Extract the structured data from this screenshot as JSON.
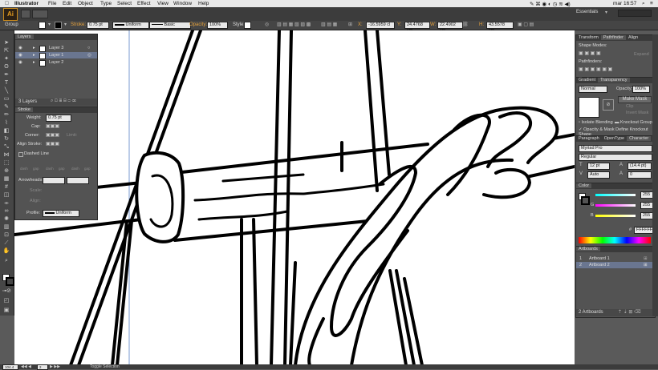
{
  "menubar": {
    "apple": "",
    "app_name": "Illustrator",
    "items": [
      "File",
      "Edit",
      "Object",
      "Type",
      "Select",
      "Effect",
      "View",
      "Window",
      "Help"
    ],
    "clock": "mar 16:57"
  },
  "appbar": {
    "logo": "Ai",
    "workspace": "Essentials"
  },
  "control": {
    "selection_label": "Group",
    "stroke_label": "Stroke:",
    "stroke_weight": "0.75 pt",
    "profile": "Uniform",
    "brush": "Basic",
    "opacity_label": "Opacity:",
    "opacity_value": "100%",
    "style_label": "Style:",
    "x_value": "-16.5959 cl",
    "y_value": "24.4768 cm",
    "w_value": "22.4902 cm",
    "h_value": "43.5578 cm",
    "x_label": "X:",
    "y_label": "Y:",
    "w_label": "W:",
    "h_label": "H:"
  },
  "layers_panel": {
    "tab": "Layers",
    "layers": [
      "Layer 3",
      "Layer 1",
      "Layer 2"
    ],
    "footer": "3 Layers"
  },
  "stroke_panel": {
    "tab": "Stroke",
    "weight_label": "Weight:",
    "weight_value": "0.75 pt",
    "cap_label": "Cap:",
    "corner_label": "Corner:",
    "limit_label": "Limit:",
    "align_label": "Align Stroke:",
    "dashed_label": "Dashed Line",
    "dash_labels": [
      "dash",
      "gap",
      "dash",
      "gap",
      "dash",
      "gap"
    ],
    "arrowheads_label": "Arrowheads:",
    "scale_label": "Scale:",
    "align2_label": "Align:",
    "profile_label": "Profile:",
    "profile_value": "Uniform"
  },
  "right_panels": {
    "tabs1": [
      "Transform",
      "Pathfinder",
      "Align"
    ],
    "shape_modes": "Shape Modes:",
    "expand": "Expand",
    "pathfinders": "Pathfinders:",
    "tabs2": [
      "Gradient",
      "Transparency"
    ],
    "blend_mode": "Normal",
    "opacity_label": "Opacity:",
    "opacity_value": "100%",
    "make_mask": "Make Mask",
    "clip": "Clip",
    "invert_mask": "Invert Mask",
    "isolate": "Isolate Blending",
    "knockout": "Knockout Group",
    "opacity_mask": "Opacity & Mask Define Knockout Shape",
    "tabs3": [
      "Paragraph",
      "OpenType",
      "Character"
    ],
    "font_family": "Myriad Pro",
    "font_style": "Regular",
    "font_size": "12 pt",
    "leading": "(14.4 pt)",
    "tracking": "Auto",
    "kerning": "0",
    "color_tab": "Color",
    "color_channels": [
      {
        "label": "",
        "value": "255"
      },
      {
        "label": "G",
        "value": "255"
      },
      {
        "label": "B",
        "value": "255"
      }
    ],
    "hex_label": "#",
    "hex_value": "FFFFFF",
    "artboards_tab": "Artboards",
    "artboards": [
      {
        "num": "1",
        "name": "Artboard 1"
      },
      {
        "num": "2",
        "name": "Artboard 2"
      }
    ],
    "artboards_footer": "2 Artboards"
  },
  "status": {
    "zoom": "104.4",
    "page": "2",
    "message": "Toggle Selection"
  }
}
